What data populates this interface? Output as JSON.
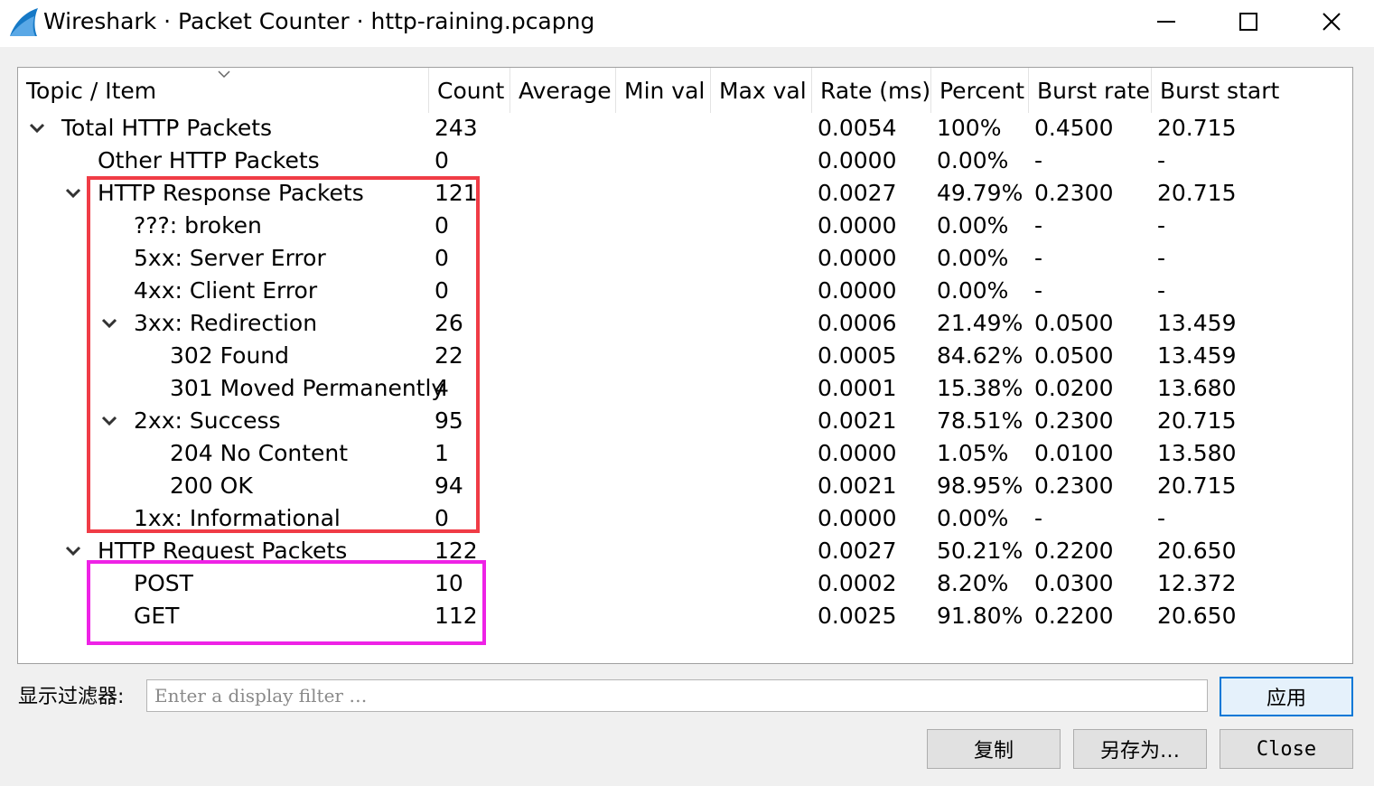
{
  "window": {
    "title": "Wireshark · Packet Counter · http-raining.pcapng",
    "icon": "wireshark-fin-icon",
    "accent": "#0078d7"
  },
  "tree": {
    "columns": [
      "Topic / Item",
      "Count",
      "Average",
      "Min val",
      "Max val",
      "Rate (ms)",
      "Percent",
      "Burst rate",
      "Burst start"
    ],
    "rows": [
      {
        "label": "Total HTTP Packets",
        "level": 0,
        "expanded": true,
        "count": "243",
        "average": "",
        "min": "",
        "max": "",
        "rate": "0.0054",
        "percent": "100%",
        "burst_rate": "0.4500",
        "burst_start": "20.715"
      },
      {
        "label": "Other HTTP Packets",
        "level": 1,
        "expanded": null,
        "count": "0",
        "average": "",
        "min": "",
        "max": "",
        "rate": "0.0000",
        "percent": "0.00%",
        "burst_rate": "-",
        "burst_start": "-"
      },
      {
        "label": "HTTP Response Packets",
        "level": 1,
        "expanded": true,
        "count": "121",
        "average": "",
        "min": "",
        "max": "",
        "rate": "0.0027",
        "percent": "49.79%",
        "burst_rate": "0.2300",
        "burst_start": "20.715"
      },
      {
        "label": "???: broken",
        "level": 2,
        "expanded": null,
        "count": "0",
        "average": "",
        "min": "",
        "max": "",
        "rate": "0.0000",
        "percent": "0.00%",
        "burst_rate": "-",
        "burst_start": "-"
      },
      {
        "label": "5xx: Server Error",
        "level": 2,
        "expanded": null,
        "count": "0",
        "average": "",
        "min": "",
        "max": "",
        "rate": "0.0000",
        "percent": "0.00%",
        "burst_rate": "-",
        "burst_start": "-"
      },
      {
        "label": "4xx: Client Error",
        "level": 2,
        "expanded": null,
        "count": "0",
        "average": "",
        "min": "",
        "max": "",
        "rate": "0.0000",
        "percent": "0.00%",
        "burst_rate": "-",
        "burst_start": "-"
      },
      {
        "label": "3xx: Redirection",
        "level": 2,
        "expanded": true,
        "count": "26",
        "average": "",
        "min": "",
        "max": "",
        "rate": "0.0006",
        "percent": "21.49%",
        "burst_rate": "0.0500",
        "burst_start": "13.459"
      },
      {
        "label": "302 Found",
        "level": 3,
        "expanded": null,
        "count": "22",
        "average": "",
        "min": "",
        "max": "",
        "rate": "0.0005",
        "percent": "84.62%",
        "burst_rate": "0.0500",
        "burst_start": "13.459"
      },
      {
        "label": "301 Moved Permanently",
        "level": 3,
        "expanded": null,
        "count": "4",
        "average": "",
        "min": "",
        "max": "",
        "rate": "0.0001",
        "percent": "15.38%",
        "burst_rate": "0.0200",
        "burst_start": "13.680"
      },
      {
        "label": "2xx: Success",
        "level": 2,
        "expanded": true,
        "count": "95",
        "average": "",
        "min": "",
        "max": "",
        "rate": "0.0021",
        "percent": "78.51%",
        "burst_rate": "0.2300",
        "burst_start": "20.715"
      },
      {
        "label": "204 No Content",
        "level": 3,
        "expanded": null,
        "count": "1",
        "average": "",
        "min": "",
        "max": "",
        "rate": "0.0000",
        "percent": "1.05%",
        "burst_rate": "0.0100",
        "burst_start": "13.580"
      },
      {
        "label": "200 OK",
        "level": 3,
        "expanded": null,
        "count": "94",
        "average": "",
        "min": "",
        "max": "",
        "rate": "0.0021",
        "percent": "98.95%",
        "burst_rate": "0.2300",
        "burst_start": "20.715"
      },
      {
        "label": "1xx: Informational",
        "level": 2,
        "expanded": null,
        "count": "0",
        "average": "",
        "min": "",
        "max": "",
        "rate": "0.0000",
        "percent": "0.00%",
        "burst_rate": "-",
        "burst_start": "-"
      },
      {
        "label": "HTTP Request Packets",
        "level": 1,
        "expanded": true,
        "count": "122",
        "average": "",
        "min": "",
        "max": "",
        "rate": "0.0027",
        "percent": "50.21%",
        "burst_rate": "0.2200",
        "burst_start": "20.650"
      },
      {
        "label": "POST",
        "level": 2,
        "expanded": null,
        "count": "10",
        "average": "",
        "min": "",
        "max": "",
        "rate": "0.0002",
        "percent": "8.20%",
        "burst_rate": "0.0300",
        "burst_start": "12.372"
      },
      {
        "label": "GET",
        "level": 2,
        "expanded": null,
        "count": "112",
        "average": "",
        "min": "",
        "max": "",
        "rate": "0.0025",
        "percent": "91.80%",
        "burst_rate": "0.2200",
        "burst_start": "20.650"
      }
    ]
  },
  "highlights": {
    "response_box_color": "#f03c46",
    "request_box_color": "#ee22e6"
  },
  "filter": {
    "label": "显示过滤器:",
    "placeholder": "Enter a display filter …",
    "value": ""
  },
  "buttons": {
    "apply": "应用",
    "copy": "复制",
    "save_as": "另存为…",
    "close": "Close"
  }
}
